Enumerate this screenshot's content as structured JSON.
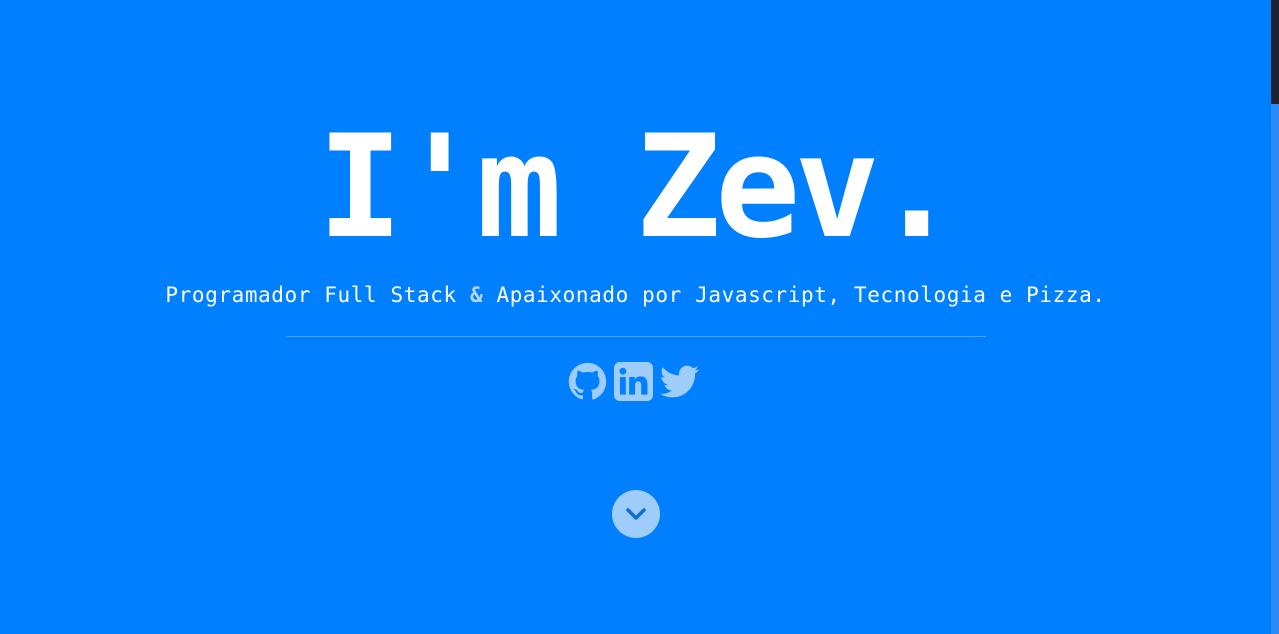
{
  "hero": {
    "title": "I'm Zev.",
    "subtitle_part1": "Programador Full Stack ",
    "subtitle_amp": "&",
    "subtitle_part2": " Apaixonado por Javascript, Tecnologia e Pizza."
  },
  "socials": [
    {
      "icon": "github-icon"
    },
    {
      "icon": "linkedin-icon"
    },
    {
      "icon": "twitter-icon"
    }
  ],
  "scroll_button": {
    "icon": "chevron-down-icon"
  },
  "colors": {
    "background": "#0080ff",
    "text": "#ffffff",
    "accent": "#9fcdfb",
    "divider": "#4fa2fa",
    "scrollbar_thumb": "#1e2331"
  }
}
